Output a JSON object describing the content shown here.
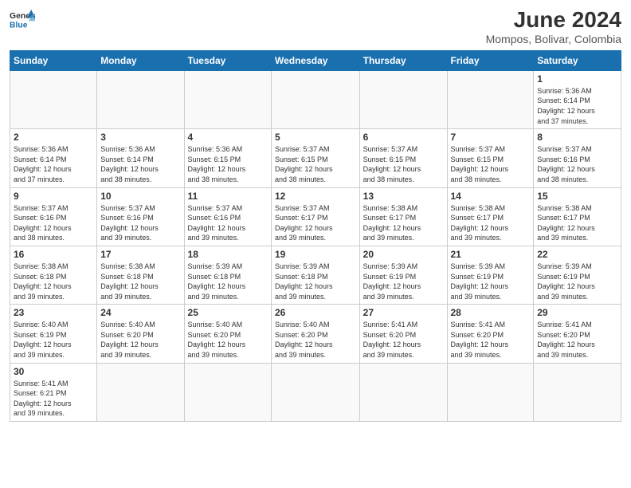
{
  "header": {
    "logo_general": "General",
    "logo_blue": "Blue",
    "month_year": "June 2024",
    "location": "Mompos, Bolivar, Colombia"
  },
  "weekdays": [
    "Sunday",
    "Monday",
    "Tuesday",
    "Wednesday",
    "Thursday",
    "Friday",
    "Saturday"
  ],
  "weeks": [
    [
      {
        "day": "",
        "info": ""
      },
      {
        "day": "",
        "info": ""
      },
      {
        "day": "",
        "info": ""
      },
      {
        "day": "",
        "info": ""
      },
      {
        "day": "",
        "info": ""
      },
      {
        "day": "",
        "info": ""
      },
      {
        "day": "1",
        "info": "Sunrise: 5:36 AM\nSunset: 6:14 PM\nDaylight: 12 hours\nand 37 minutes."
      }
    ],
    [
      {
        "day": "2",
        "info": "Sunrise: 5:36 AM\nSunset: 6:14 PM\nDaylight: 12 hours\nand 37 minutes."
      },
      {
        "day": "3",
        "info": "Sunrise: 5:36 AM\nSunset: 6:14 PM\nDaylight: 12 hours\nand 38 minutes."
      },
      {
        "day": "4",
        "info": "Sunrise: 5:36 AM\nSunset: 6:15 PM\nDaylight: 12 hours\nand 38 minutes."
      },
      {
        "day": "5",
        "info": "Sunrise: 5:37 AM\nSunset: 6:15 PM\nDaylight: 12 hours\nand 38 minutes."
      },
      {
        "day": "6",
        "info": "Sunrise: 5:37 AM\nSunset: 6:15 PM\nDaylight: 12 hours\nand 38 minutes."
      },
      {
        "day": "7",
        "info": "Sunrise: 5:37 AM\nSunset: 6:15 PM\nDaylight: 12 hours\nand 38 minutes."
      },
      {
        "day": "8",
        "info": "Sunrise: 5:37 AM\nSunset: 6:16 PM\nDaylight: 12 hours\nand 38 minutes."
      }
    ],
    [
      {
        "day": "9",
        "info": "Sunrise: 5:37 AM\nSunset: 6:16 PM\nDaylight: 12 hours\nand 38 minutes."
      },
      {
        "day": "10",
        "info": "Sunrise: 5:37 AM\nSunset: 6:16 PM\nDaylight: 12 hours\nand 39 minutes."
      },
      {
        "day": "11",
        "info": "Sunrise: 5:37 AM\nSunset: 6:16 PM\nDaylight: 12 hours\nand 39 minutes."
      },
      {
        "day": "12",
        "info": "Sunrise: 5:37 AM\nSunset: 6:17 PM\nDaylight: 12 hours\nand 39 minutes."
      },
      {
        "day": "13",
        "info": "Sunrise: 5:38 AM\nSunset: 6:17 PM\nDaylight: 12 hours\nand 39 minutes."
      },
      {
        "day": "14",
        "info": "Sunrise: 5:38 AM\nSunset: 6:17 PM\nDaylight: 12 hours\nand 39 minutes."
      },
      {
        "day": "15",
        "info": "Sunrise: 5:38 AM\nSunset: 6:17 PM\nDaylight: 12 hours\nand 39 minutes."
      }
    ],
    [
      {
        "day": "16",
        "info": "Sunrise: 5:38 AM\nSunset: 6:18 PM\nDaylight: 12 hours\nand 39 minutes."
      },
      {
        "day": "17",
        "info": "Sunrise: 5:38 AM\nSunset: 6:18 PM\nDaylight: 12 hours\nand 39 minutes."
      },
      {
        "day": "18",
        "info": "Sunrise: 5:39 AM\nSunset: 6:18 PM\nDaylight: 12 hours\nand 39 minutes."
      },
      {
        "day": "19",
        "info": "Sunrise: 5:39 AM\nSunset: 6:18 PM\nDaylight: 12 hours\nand 39 minutes."
      },
      {
        "day": "20",
        "info": "Sunrise: 5:39 AM\nSunset: 6:19 PM\nDaylight: 12 hours\nand 39 minutes."
      },
      {
        "day": "21",
        "info": "Sunrise: 5:39 AM\nSunset: 6:19 PM\nDaylight: 12 hours\nand 39 minutes."
      },
      {
        "day": "22",
        "info": "Sunrise: 5:39 AM\nSunset: 6:19 PM\nDaylight: 12 hours\nand 39 minutes."
      }
    ],
    [
      {
        "day": "23",
        "info": "Sunrise: 5:40 AM\nSunset: 6:19 PM\nDaylight: 12 hours\nand 39 minutes."
      },
      {
        "day": "24",
        "info": "Sunrise: 5:40 AM\nSunset: 6:20 PM\nDaylight: 12 hours\nand 39 minutes."
      },
      {
        "day": "25",
        "info": "Sunrise: 5:40 AM\nSunset: 6:20 PM\nDaylight: 12 hours\nand 39 minutes."
      },
      {
        "day": "26",
        "info": "Sunrise: 5:40 AM\nSunset: 6:20 PM\nDaylight: 12 hours\nand 39 minutes."
      },
      {
        "day": "27",
        "info": "Sunrise: 5:41 AM\nSunset: 6:20 PM\nDaylight: 12 hours\nand 39 minutes."
      },
      {
        "day": "28",
        "info": "Sunrise: 5:41 AM\nSunset: 6:20 PM\nDaylight: 12 hours\nand 39 minutes."
      },
      {
        "day": "29",
        "info": "Sunrise: 5:41 AM\nSunset: 6:20 PM\nDaylight: 12 hours\nand 39 minutes."
      }
    ],
    [
      {
        "day": "30",
        "info": "Sunrise: 5:41 AM\nSunset: 6:21 PM\nDaylight: 12 hours\nand 39 minutes."
      },
      {
        "day": "",
        "info": ""
      },
      {
        "day": "",
        "info": ""
      },
      {
        "day": "",
        "info": ""
      },
      {
        "day": "",
        "info": ""
      },
      {
        "day": "",
        "info": ""
      },
      {
        "day": "",
        "info": ""
      }
    ]
  ]
}
